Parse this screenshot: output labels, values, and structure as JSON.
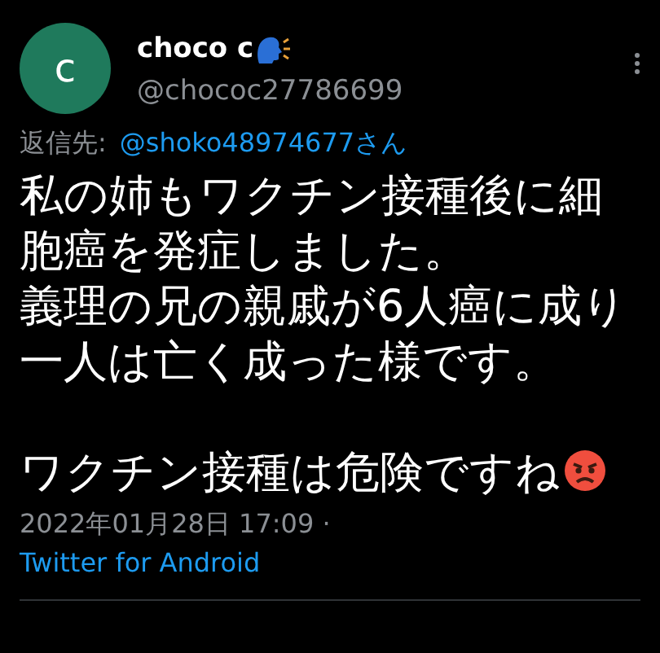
{
  "author": {
    "avatar_letter": "c",
    "name": "choco c",
    "handle": "@chococ27786699"
  },
  "reply_to": {
    "label": "返信先:",
    "handle": "@shoko48974677さん"
  },
  "body": [
    "私の姉もワクチン接種後に細胞癌を発症しました。",
    "義理の兄の親戚が6人癌に成り一人は亡く成った様です。",
    "ワクチン接種は危険ですね"
  ],
  "timestamp": "2022年01月28日 17:09 ·",
  "source": "Twitter for Android"
}
